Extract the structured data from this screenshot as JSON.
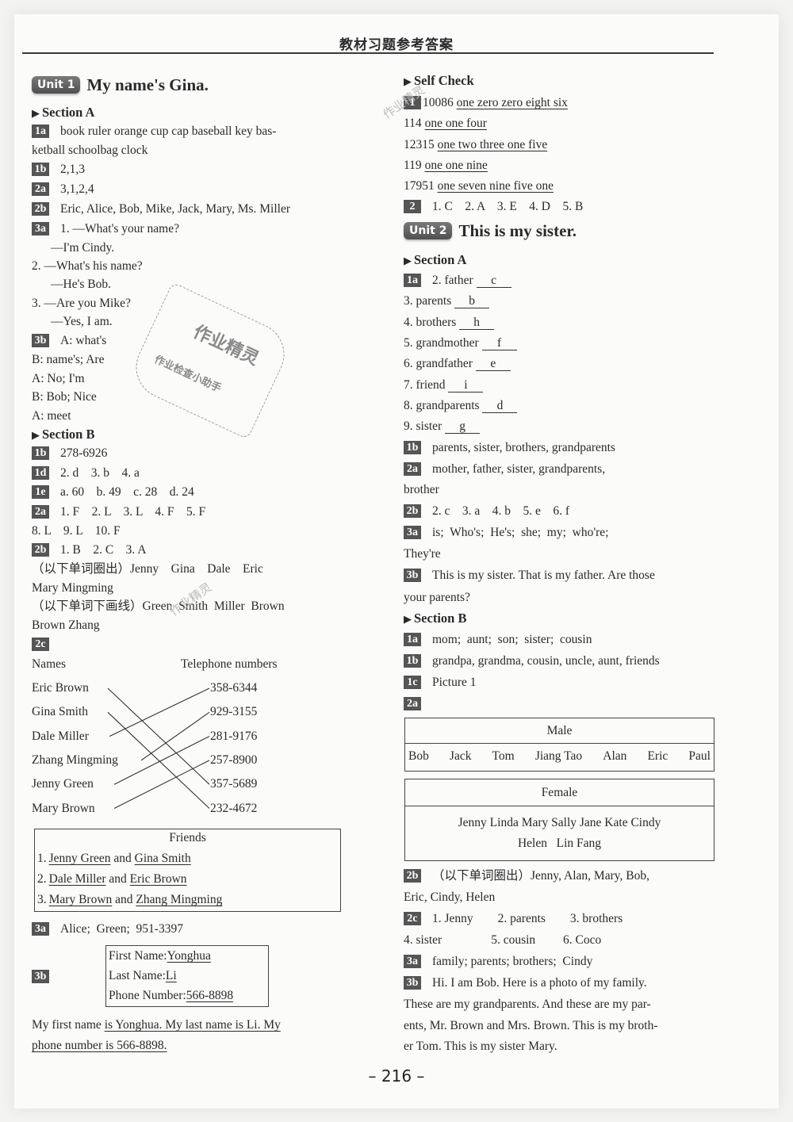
{
  "header": {
    "title": "教材习题参考答案"
  },
  "page_number": "– 216 –",
  "watermarks": {
    "stamp_main": "作业精灵",
    "stamp_sub": "作业检查小助手",
    "small": "作业精灵"
  },
  "unit1": {
    "pill": "Unit 1",
    "title": "My name's Gina.",
    "sectionA": {
      "label": "Section A",
      "items": [
        {
          "badge": "1a",
          "lines": [
            "book ruler orange cup cap baseball key bas-",
            "ketball schoolbag clock"
          ]
        },
        {
          "badge": "1b",
          "lines": [
            "2,1,3"
          ]
        },
        {
          "badge": "2a",
          "lines": [
            "3,1,2,4"
          ]
        },
        {
          "badge": "2b",
          "lines": [
            "Eric, Alice, Bob, Mike, Jack, Mary, Ms. Miller"
          ]
        },
        {
          "badge": "3a",
          "lines": [
            "1. —What's your name?",
            "—I'm Cindy.",
            "2. —What's his name?",
            "—He's Bob.",
            "3. —Are you Mike?",
            "—Yes, I am."
          ]
        },
        {
          "badge": "3b",
          "lines": [
            "A: what's",
            "B: name's;  Are",
            "A: No;  I'm",
            "B: Bob; Nice",
            "A: meet"
          ]
        }
      ]
    },
    "sectionB": {
      "label": "Section B",
      "items": [
        {
          "badge": "1b",
          "lines": [
            "278-6926"
          ]
        },
        {
          "badge": "1d",
          "lines": [
            "2. d    3. b    4. a"
          ]
        },
        {
          "badge": "1e",
          "lines": [
            "a. 60    b. 49    c. 28    d. 24"
          ]
        },
        {
          "badge": "2a",
          "lines": [
            "1. F    2. L    3. L    4. F    5. F",
            "8. L    9. L    10. F"
          ]
        },
        {
          "badge": "2b",
          "lines": [
            "1. B    2. C    3. A",
            "（以下单词圈出）Jenny    Gina    Dale    Eric",
            "Mary Mingming",
            "（以下单词下画线）Green  Smith  Miller  Brown",
            "Brown Zhang"
          ]
        },
        {
          "badge": "2c"
        }
      ],
      "matching": {
        "names_header": "Names",
        "phones_header": "Telephone numbers",
        "names": [
          "Eric Brown",
          "Gina Smith",
          "Dale Miller",
          "Zhang Mingming",
          "Jenny Green",
          "Mary Brown"
        ],
        "phones": [
          "358-6344",
          "929-3155",
          "281-9176",
          "257-8900",
          "357-5689",
          "232-4672"
        ],
        "links": [
          [
            0,
            4
          ],
          [
            1,
            5
          ],
          [
            2,
            0
          ],
          [
            3,
            1
          ],
          [
            4,
            2
          ],
          [
            5,
            3
          ]
        ]
      },
      "friends": {
        "title": "Friends",
        "rows": [
          {
            "num": "1.",
            "a": "Jenny Green",
            "and": "and",
            "b": "Gina Smith"
          },
          {
            "num": "2.",
            "a": "Dale Miller",
            "and": "and",
            "b": "Eric Brown"
          },
          {
            "num": "3.",
            "a": "Mary Brown",
            "and": "and",
            "b": "Zhang Mingming"
          }
        ]
      },
      "item3a": {
        "badge": "3a",
        "text": "Alice;  Green;  951-3397"
      },
      "item3b": {
        "badge": "3b",
        "card": [
          {
            "label": "First Name:",
            "value": "Yonghua"
          },
          {
            "label": "Last Name:",
            "value": "Li"
          },
          {
            "label": "Phone Number:",
            "value": "566-8898"
          }
        ],
        "sentence_prefix": "My first name ",
        "sentence_underlined_1": "is Yonghua. My last name is Li. My",
        "sentence_underlined_2": "phone number is 566-8898."
      }
    },
    "selfCheck": {
      "label": "Self Check",
      "item1": {
        "badge": "1",
        "rows": [
          {
            "num": "10086",
            "words": "one zero zero eight six"
          },
          {
            "num": "114",
            "words": "one one four"
          },
          {
            "num": "12315",
            "words": "one two three one five"
          },
          {
            "num": "119",
            "words": "one one nine"
          },
          {
            "num": "17951",
            "words": "one seven nine five one"
          }
        ]
      },
      "item2": {
        "badge": "2",
        "text": "1. C    2. A    3. E    4. D    5. B"
      }
    }
  },
  "unit2": {
    "pill": "Unit 2",
    "title": "This is my sister.",
    "sectionA": {
      "label": "Section A",
      "item1a": {
        "badge": "1a",
        "rows": [
          {
            "word": "2. father",
            "answer": "c"
          },
          {
            "word": "3. parents",
            "answer": "b"
          },
          {
            "word": "4. brothers",
            "answer": "h"
          },
          {
            "word": "5. grandmother",
            "answer": "f"
          },
          {
            "word": "6. grandfather",
            "answer": "e"
          },
          {
            "word": "7. friend",
            "answer": "i"
          },
          {
            "word": "8. grandparents",
            "answer": "d"
          },
          {
            "word": "9. sister",
            "answer": "g"
          }
        ]
      },
      "items": [
        {
          "badge": "1b",
          "lines": [
            "parents, sister, brothers, grandparents"
          ]
        },
        {
          "badge": "2a",
          "lines": [
            "mother, father, sister, grandparents,",
            "brother"
          ]
        },
        {
          "badge": "2b",
          "lines": [
            "2. c    3. a    4. b    5. e    6. f"
          ]
        },
        {
          "badge": "3a",
          "lines": [
            "is;  Who's;  He's;  she;  my;  who're;",
            "They're"
          ]
        },
        {
          "badge": "3b",
          "lines": [
            "This is my sister. That is my father. Are those",
            "your parents?"
          ]
        }
      ]
    },
    "sectionB": {
      "label": "Section B",
      "items": [
        {
          "badge": "1a",
          "lines": [
            "mom;  aunt;  son;  sister;  cousin"
          ]
        },
        {
          "badge": "1b",
          "lines": [
            "grandpa, grandma, cousin, uncle, aunt, friends"
          ]
        },
        {
          "badge": "1c",
          "lines": [
            "Picture 1"
          ]
        },
        {
          "badge": "2a"
        }
      ],
      "male_table": {
        "header": "Male",
        "names": [
          "Bob",
          "Jack",
          "Tom",
          "Jiang Tao",
          "Alan",
          "Eric",
          "Paul"
        ]
      },
      "female_table": {
        "header": "Female",
        "line1": "Jenny Linda Mary Sally Jane Kate Cindy",
        "line2": "Helen   Lin Fang"
      },
      "items_after": [
        {
          "badge": "2b",
          "lines": [
            "（以下单词圈出）Jenny, Alan, Mary, Bob,",
            "Eric, Cindy, Helen"
          ]
        },
        {
          "badge": "2c",
          "lines": [
            "1. Jenny        2. parents        3. brothers",
            "4. sister                5. cousin         6. Coco"
          ]
        },
        {
          "badge": "3a",
          "lines": [
            "family; parents; brothers;  Cindy"
          ]
        },
        {
          "badge": "3b",
          "lines": [
            "Hi. I am Bob. Here is a photo of my family.",
            "These are my grandparents. And these are my par-",
            "ents, Mr. Brown and Mrs. Brown. This is my broth-",
            "er Tom. This is my sister Mary."
          ]
        }
      ]
    }
  }
}
